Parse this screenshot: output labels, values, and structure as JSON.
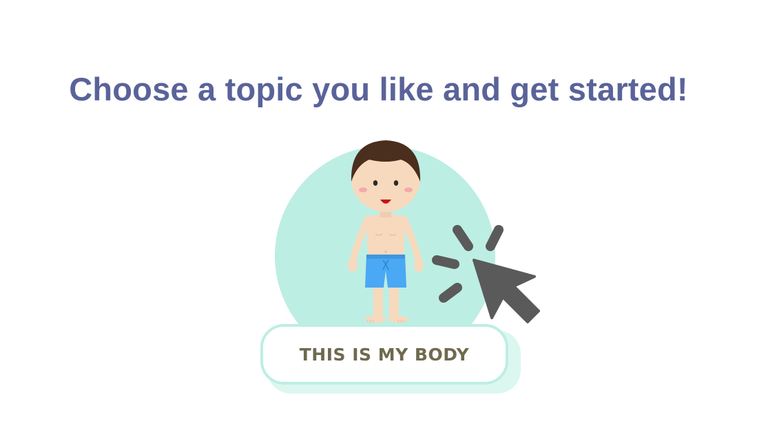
{
  "heading": "Choose a topic you like and get started!",
  "topic": {
    "label": "THIS IS MY BODY",
    "illustration": "boy-in-swim-shorts",
    "pointer_icon": "cursor-click-icon"
  },
  "colors": {
    "heading": "#5a6399",
    "circle": "#bdeee3",
    "label_text": "#6f6a4f",
    "cursor": "#5a5a5a",
    "shorts": "#4aa8f5",
    "hair": "#4a2e1e",
    "skin": "#f7d9bd"
  }
}
